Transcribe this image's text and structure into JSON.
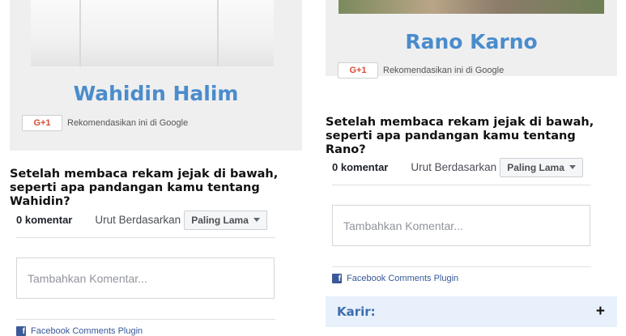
{
  "left": {
    "name": "Wahidin Halim",
    "gplus_label": "G+1",
    "gplus_text": "Rekomendasikan ini di Google",
    "question": "Setelah membaca rekam jejak di bawah, seperti apa pandangan kamu tentang Wahidin?",
    "comments": {
      "count": "0 komentar",
      "sort_label": "Urut Berdasarkan",
      "sort_value": "Paling Lama",
      "placeholder": "Tambahkan Komentar...",
      "plugin_text": "Facebook Comments Plugin"
    }
  },
  "right": {
    "name": "Rano Karno",
    "gplus_label": "G+1",
    "gplus_text": "Rekomendasikan ini di Google",
    "question": "Setelah membaca rekam jejak di bawah, seperti apa pandangan kamu tentang Rano?",
    "comments": {
      "count": "0 komentar",
      "sort_label": "Urut Berdasarkan",
      "sort_value": "Paling Lama",
      "placeholder": "Tambahkan Komentar...",
      "plugin_text": "Facebook Comments Plugin"
    },
    "section": {
      "title": "Karir:",
      "toggle": "+"
    }
  },
  "icons": {
    "facebook": "facebook-icon",
    "caret": "chevron-down-icon",
    "expand": "plus-icon"
  }
}
